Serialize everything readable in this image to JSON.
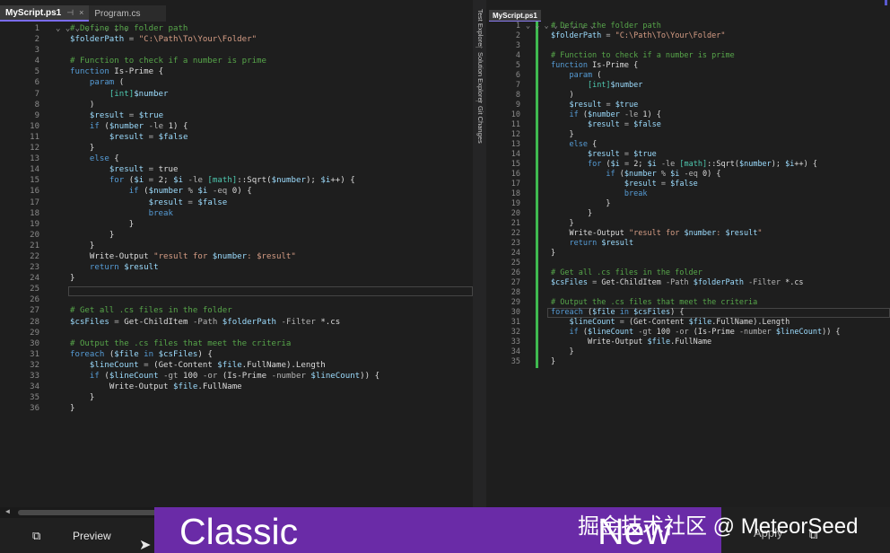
{
  "left": {
    "tabs": [
      {
        "label": "MyScript.ps1",
        "pin": "⊣",
        "close": "×"
      },
      {
        "label": "Program.cs"
      }
    ]
  },
  "side_tabs": [
    "Test Explorer",
    "Solution Explorer",
    "Git Changes"
  ],
  "right": {
    "tab_label": "MyScript.ps1"
  },
  "bottom": {
    "preview_label": "Preview",
    "classic_label": "Classic",
    "new_label": "New",
    "apply_label": "Apply",
    "watermark": "掘金技术社区 @ MeteorSeed"
  }
}
